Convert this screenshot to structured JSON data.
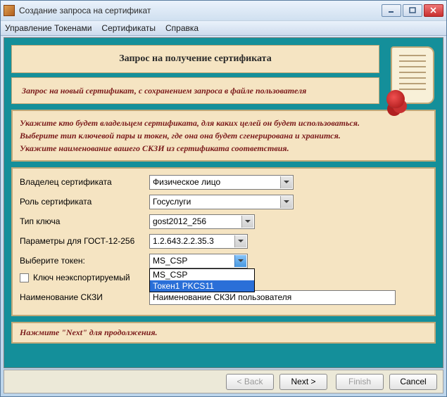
{
  "window": {
    "title": "Создание запроса на сертификат"
  },
  "menu": {
    "tokens": "Управление Токенами",
    "certs": "Сертификаты",
    "help": "Справка"
  },
  "header": {
    "title": "Запрос на получение сертификата",
    "subtitle": "Запрос на новый сертификат, с сохранением запроса в файле пользователя"
  },
  "info": {
    "line1": "Укажите кто будет владельцем сертификата, для каких целей он будет использоваться.",
    "line2": "Выберите тип ключевой пары и токен, где она она будет сгенерирована и хранится.",
    "line3": "Укажите наименование вашего СКЗИ из сертификата соответствия."
  },
  "form": {
    "owner": {
      "label": "Владелец сертификата",
      "value": "Физическое лицо"
    },
    "role": {
      "label": "Роль сертификата",
      "value": "Госуслуги"
    },
    "keytype": {
      "label": "Тип ключа",
      "value": "gost2012_256"
    },
    "gostparams": {
      "label": "Параметры для ГОСТ-12-256",
      "value": "1.2.643.2.2.35.3"
    },
    "token": {
      "label": "Выберите токен:",
      "value": "MS_CSP",
      "options": [
        "MS_CSP",
        "Токен1 PKCS11"
      ],
      "selected_index": 1
    },
    "noexport": {
      "label": "Ключ неэкспортируемый"
    },
    "skzi": {
      "label": "Наименование СКЗИ",
      "value": "Наименование СКЗИ пользователя"
    }
  },
  "hint": "Нажмите \"Next\" для продолжения.",
  "buttons": {
    "back": "< Back",
    "next": "Next >",
    "finish": "Finish",
    "cancel": "Cancel"
  }
}
